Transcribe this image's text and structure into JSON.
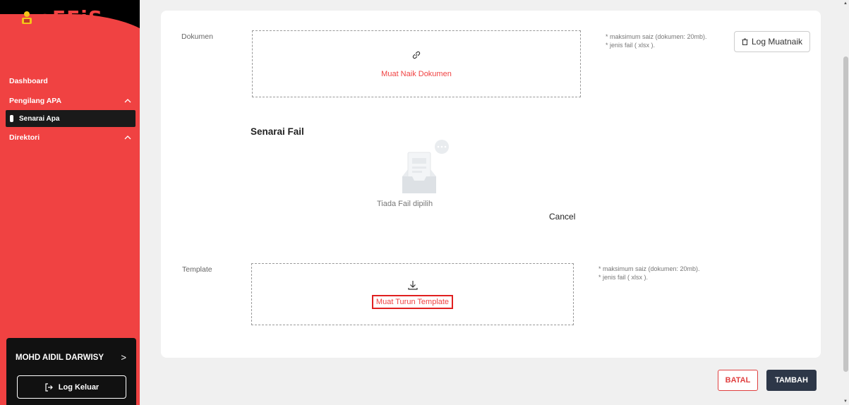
{
  "sidebar": {
    "logo_text": "eFEiS",
    "items": [
      {
        "label": "Dashboard"
      },
      {
        "label": "Pengilang APA",
        "chevron": "^"
      },
      {
        "label": "Senarai Apa"
      },
      {
        "label": "Direktori",
        "chevron": "^"
      }
    ],
    "user_name": "MOHD AIDIL DARWISY",
    "user_arrow": ">",
    "logout_label": "Log Keluar"
  },
  "form": {
    "dokumen_label": "Dokumen",
    "upload_label": "Muat Naik Dokumen",
    "hint_size": "* maksimum saiz (dokumen: 20mb).",
    "hint_type": "* jenis fail ( xlsx ).",
    "log_button": "Log Muatnaik",
    "files_title": "Senarai Fail",
    "empty_text": "Tiada Fail dipilih",
    "cancel_label": "Cancel",
    "template_label": "Template",
    "download_label": "Muat Turun Template",
    "tpl_hint_size": "* maksimum saiz (dokumen: 20mb).",
    "tpl_hint_type": "* jenis fail ( xlsx )."
  },
  "actions": {
    "batal": "BATAL",
    "tambah": "TAMBAH"
  },
  "colors": {
    "brand_red": "#f04242",
    "dark": "#2d3748"
  }
}
